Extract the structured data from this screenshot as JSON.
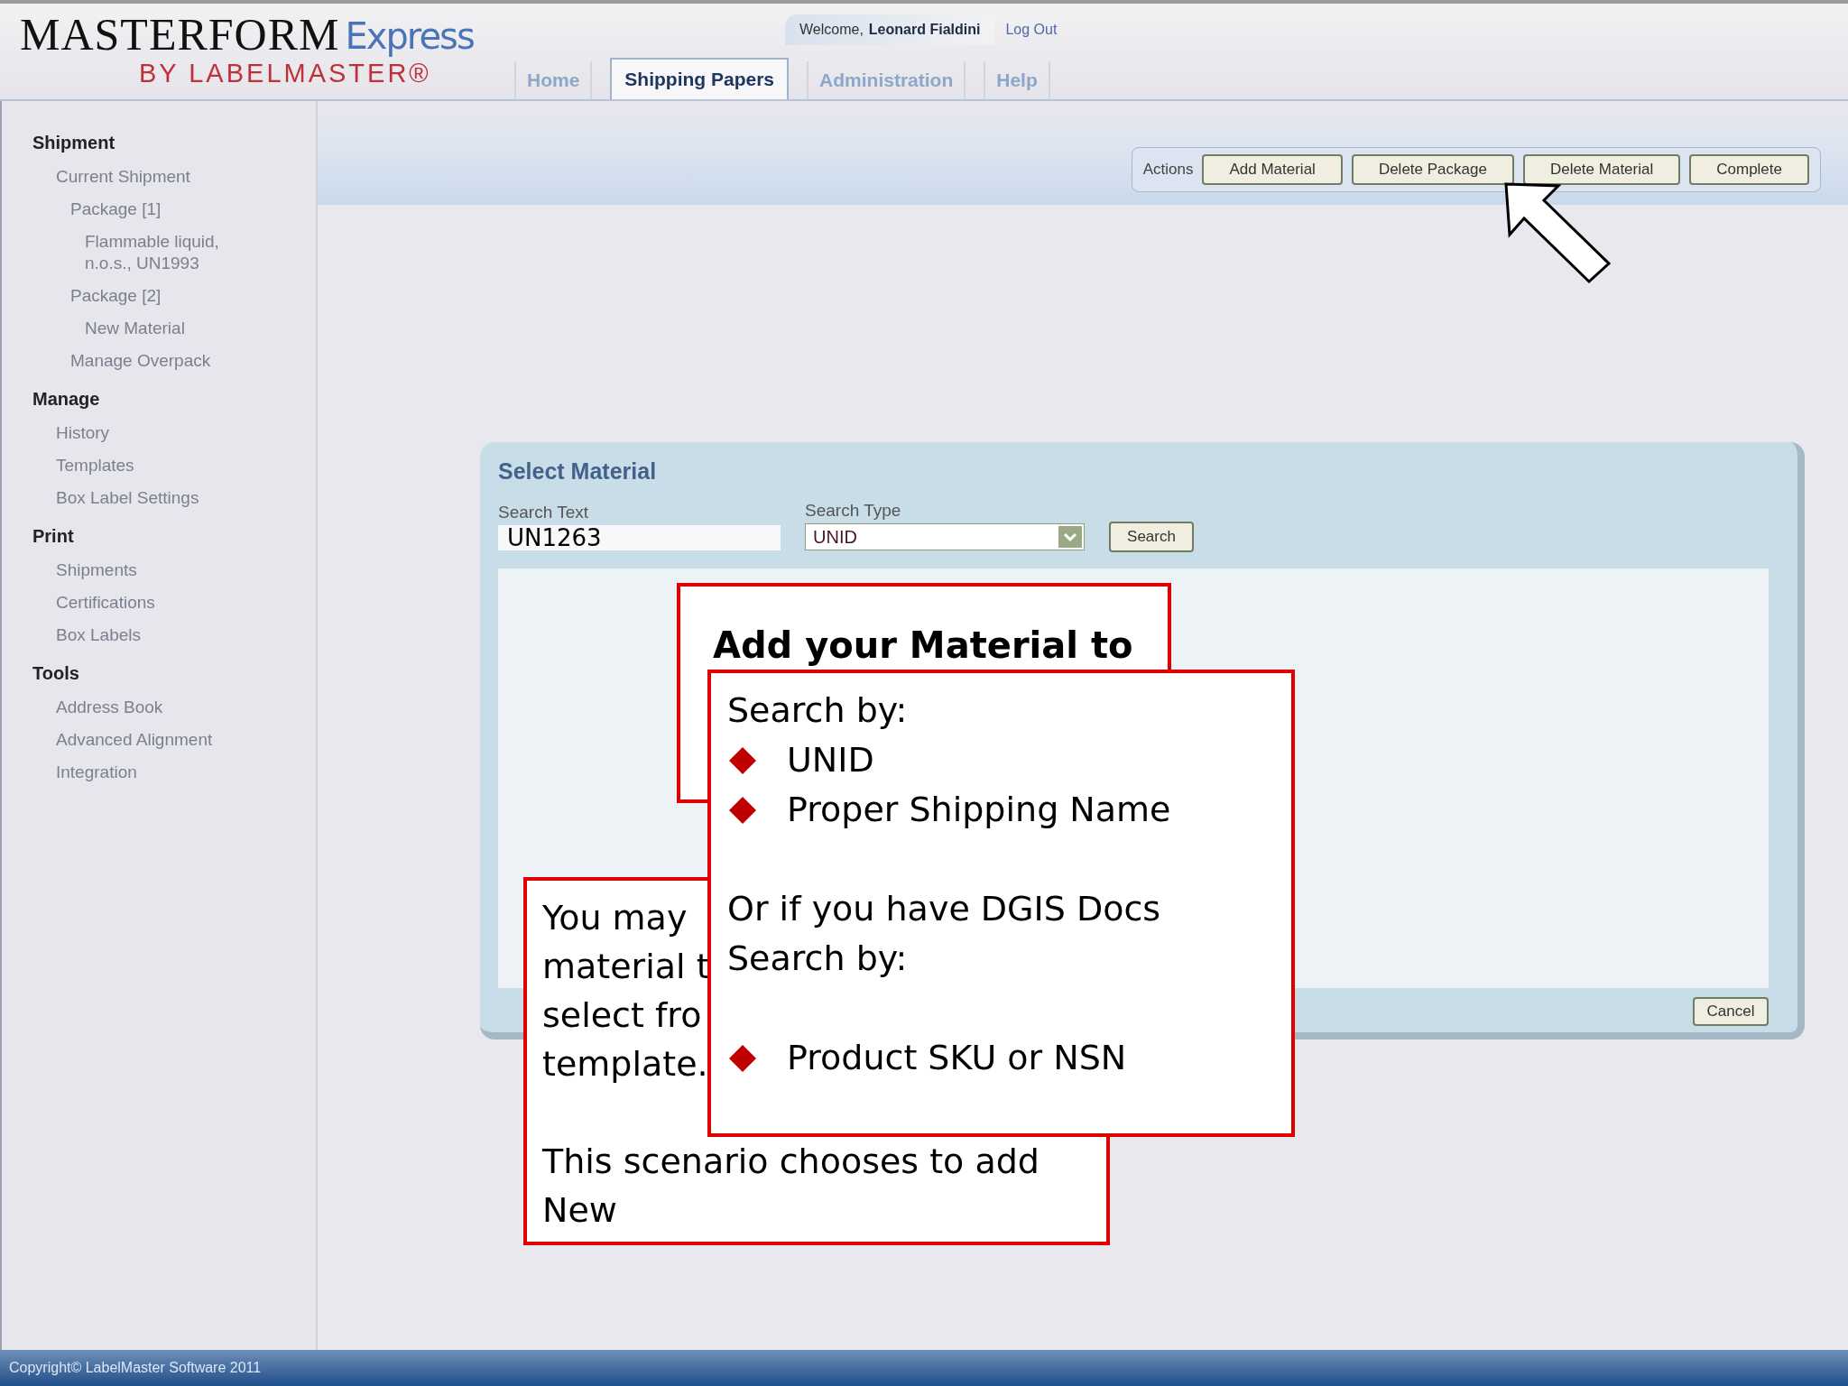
{
  "header": {
    "logo": {
      "name": "MASTERFORM",
      "suffix": "Express",
      "byline": "BY LABELMASTER®"
    },
    "welcome": "Welcome,",
    "user": "Leonard Fialdini",
    "logout": "Log Out"
  },
  "tabs": [
    {
      "label": "Home",
      "selected": false
    },
    {
      "label": "Shipping Papers",
      "selected": true
    },
    {
      "label": "Administration",
      "selected": false
    },
    {
      "label": "Help",
      "selected": false
    }
  ],
  "sidebar": {
    "sections": [
      {
        "title": "Shipment",
        "items": [
          {
            "label": "Current Shipment",
            "children": [
              {
                "label": "Package [1]",
                "children": [
                  {
                    "label": "Flammable liquid, n.o.s., UN1993"
                  }
                ]
              },
              {
                "label": "Package [2]",
                "children": [
                  {
                    "label": "New Material"
                  }
                ]
              },
              {
                "label": "Manage Overpack"
              }
            ]
          }
        ]
      },
      {
        "title": "Manage",
        "items": [
          {
            "label": "History"
          },
          {
            "label": "Templates"
          },
          {
            "label": "Box Label Settings"
          }
        ]
      },
      {
        "title": "Print",
        "items": [
          {
            "label": "Shipments"
          },
          {
            "label": "Certifications"
          },
          {
            "label": "Box Labels"
          }
        ]
      },
      {
        "title": "Tools",
        "items": [
          {
            "label": "Address Book"
          },
          {
            "label": "Advanced Alignment"
          },
          {
            "label": "Integration"
          }
        ]
      }
    ]
  },
  "actions": {
    "label": "Actions",
    "buttons": [
      "Add Material",
      "Delete Package",
      "Delete Material",
      "Complete"
    ]
  },
  "dialog": {
    "title": "Select Material",
    "search_text": {
      "label": "Search Text",
      "value": "UN1263"
    },
    "search_type": {
      "label": "Search Type",
      "value": "UNID"
    },
    "search_button": "Search",
    "cancel_button": "Cancel"
  },
  "callouts": {
    "add_material": {
      "text": "Add your Material to"
    },
    "search_by": {
      "lines": [
        {
          "kind": "text",
          "text": "Search by:"
        },
        {
          "kind": "bullet",
          "text": "UNID"
        },
        {
          "kind": "bullet",
          "text": "Proper Shipping Name"
        },
        {
          "kind": "spacer"
        },
        {
          "kind": "text",
          "text": "Or if you have DGIS Docs"
        },
        {
          "kind": "text",
          "text": "Search by:"
        },
        {
          "kind": "spacer"
        },
        {
          "kind": "bullet",
          "text": "Product SKU or NSN"
        }
      ]
    },
    "template": {
      "lines": [
        "You may",
        "material t",
        "select fro",
        "template."
      ],
      "note": "This scenario chooses to add New"
    }
  },
  "footer": {
    "copyright": "Copyright© LabelMaster Software 2011"
  }
}
